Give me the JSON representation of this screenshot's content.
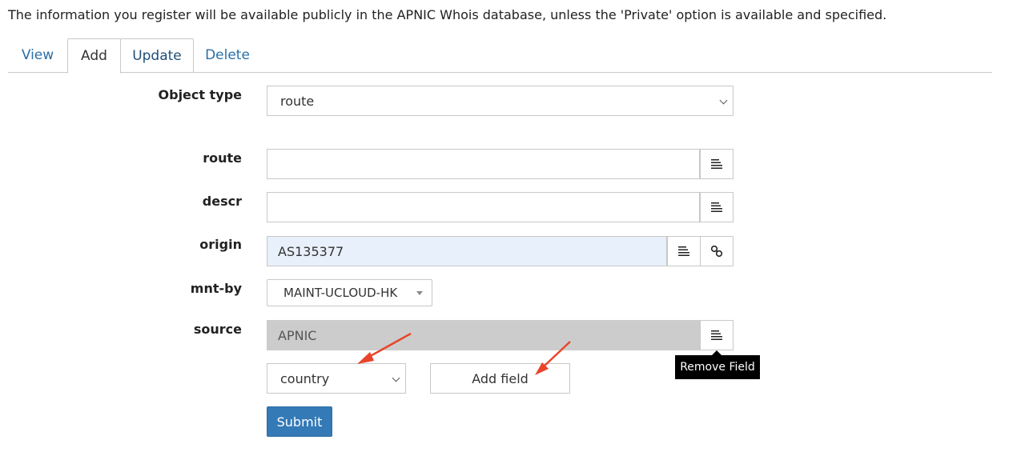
{
  "notice": "The information you register will be available publicly in the APNIC Whois database, unless the 'Private' option is available and specified.",
  "tabs": [
    {
      "label": "View"
    },
    {
      "label": "Add"
    },
    {
      "label": "Update"
    },
    {
      "label": "Delete"
    }
  ],
  "active_tab": "Add",
  "form": {
    "object_type": {
      "label": "Object type",
      "value": "route"
    },
    "route": {
      "label": "route",
      "value": ""
    },
    "descr": {
      "label": "descr",
      "value": ""
    },
    "origin": {
      "label": "origin",
      "value": "AS135377"
    },
    "mnt_by": {
      "label": "mnt-by",
      "value": "MAINT-UCLOUD-HK"
    },
    "source": {
      "label": "source",
      "value": "APNIC"
    },
    "add_field_select": {
      "value": "country"
    },
    "add_field_button": "Add field",
    "submit_button": "Submit"
  },
  "tooltip": "Remove Field",
  "colors": {
    "link": "#2a6fa8",
    "submit": "#337ab7",
    "origin_bg": "#e8f0fb",
    "source_bg": "#cccccc",
    "annotation_arrow": "#e8452c"
  },
  "icons": [
    "lines-icon",
    "link-icon",
    "chevron-down-icon",
    "caret-down-icon"
  ]
}
